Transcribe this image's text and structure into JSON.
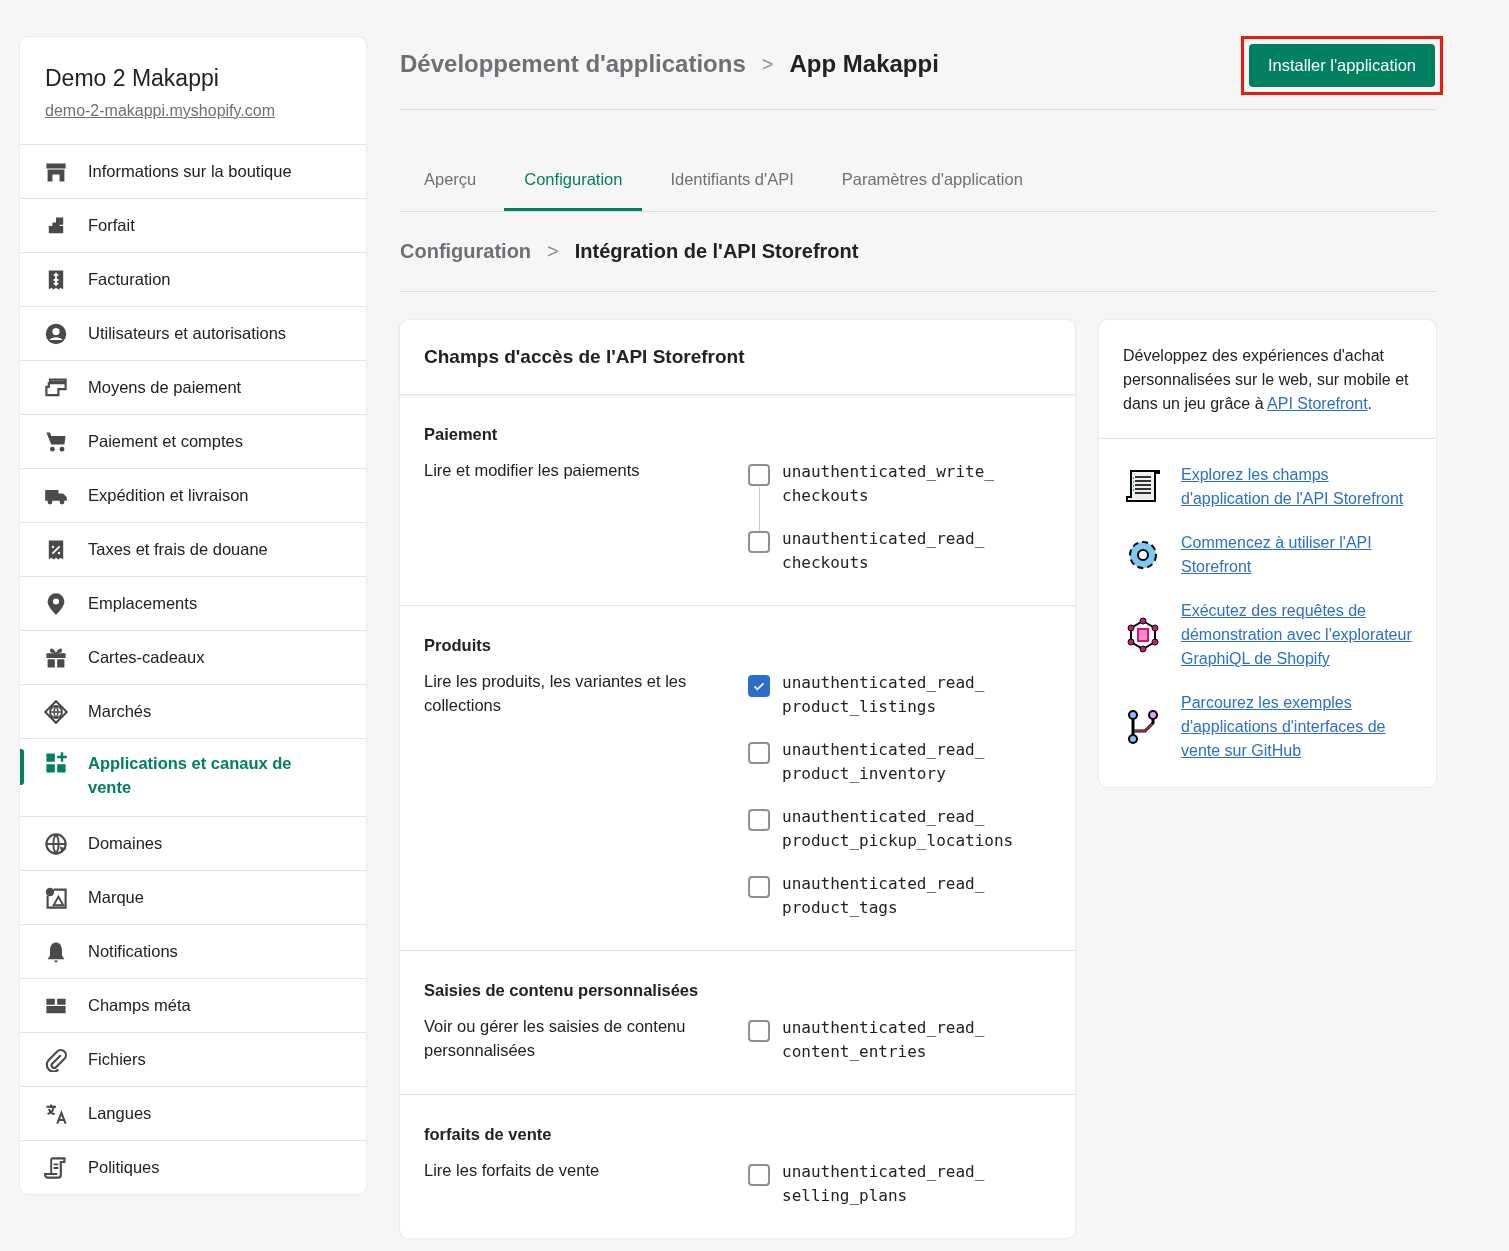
{
  "store": {
    "name": "Demo 2 Makappi",
    "domain": "demo-2-makappi.myshopify.com"
  },
  "sidebar": {
    "items": [
      {
        "label": "Informations sur la boutique",
        "selected": false
      },
      {
        "label": "Forfait",
        "selected": false
      },
      {
        "label": "Facturation",
        "selected": false
      },
      {
        "label": "Utilisateurs et autorisations",
        "selected": false
      },
      {
        "label": "Moyens de paiement",
        "selected": false
      },
      {
        "label": "Paiement et comptes",
        "selected": false
      },
      {
        "label": "Expédition et livraison",
        "selected": false
      },
      {
        "label": "Taxes et frais de douane",
        "selected": false
      },
      {
        "label": "Emplacements",
        "selected": false
      },
      {
        "label": "Cartes-cadeaux",
        "selected": false
      },
      {
        "label": "Marchés",
        "selected": false
      },
      {
        "label": "Applications et canaux de vente",
        "selected": true
      },
      {
        "label": "Domaines",
        "selected": false
      },
      {
        "label": "Marque",
        "selected": false
      },
      {
        "label": "Notifications",
        "selected": false
      },
      {
        "label": "Champs méta",
        "selected": false
      },
      {
        "label": "Fichiers",
        "selected": false
      },
      {
        "label": "Langues",
        "selected": false
      },
      {
        "label": "Politiques",
        "selected": false
      }
    ]
  },
  "breadcrumb": {
    "parent": "Développement d'applications",
    "separator": ">",
    "current": "App Makappi"
  },
  "install_button": {
    "label": "Installer l'application",
    "highlighted": true
  },
  "tabs": [
    {
      "label": "Aperçu",
      "selected": false
    },
    {
      "label": "Configuration",
      "selected": true
    },
    {
      "label": "Identifiants d'API",
      "selected": false
    },
    {
      "label": "Paramètres d'application",
      "selected": false
    }
  ],
  "sub_breadcrumb": {
    "parent": "Configuration",
    "separator": ">",
    "current": "Intégration de l'API Storefront"
  },
  "scopes_card": {
    "title": "Champs d'accès de l'API Storefront",
    "groups": [
      {
        "title": "Paiement",
        "description": "Lire et modifier les paiements",
        "scopes": [
          {
            "name": "unauthenticated_write_\ncheckouts",
            "checked": false,
            "linked_to_next": true
          },
          {
            "name": "unauthenticated_read_\ncheckouts",
            "checked": false,
            "linked_to_next": false
          }
        ]
      },
      {
        "title": "Produits",
        "description": "Lire les produits, les variantes et les collections",
        "scopes": [
          {
            "name": "unauthenticated_read_\nproduct_listings",
            "checked": true,
            "linked_to_next": false
          },
          {
            "name": "unauthenticated_read_\nproduct_inventory",
            "checked": false,
            "linked_to_next": false
          },
          {
            "name": "unauthenticated_read_\nproduct_pickup_locations",
            "checked": false,
            "linked_to_next": false
          },
          {
            "name": "unauthenticated_read_\nproduct_tags",
            "checked": false,
            "linked_to_next": false
          }
        ]
      },
      {
        "title": "Saisies de contenu personnalisées",
        "description": "Voir ou gérer les saisies de contenu personnalisées",
        "scopes": [
          {
            "name": "unauthenticated_read_\ncontent_entries",
            "checked": false,
            "linked_to_next": false
          }
        ]
      },
      {
        "title": "forfaits de vente",
        "description": "Lire les forfaits de vente",
        "scopes": [
          {
            "name": "unauthenticated_read_\nselling_plans",
            "checked": false,
            "linked_to_next": false
          }
        ]
      }
    ]
  },
  "info_card": {
    "intro": "Développez des expériences d'achat personnalisées sur le web, sur mobile et dans un jeu grâce à",
    "intro_link": "API Storefront",
    "intro_end": ".",
    "resources": [
      {
        "label": "Explorez les champs d'application de l'API Storefront"
      },
      {
        "label": "Commencez à utiliser l'API Storefront"
      },
      {
        "label": "Exécutez des requêtes de démonstration avec l'explorateur GraphiQL de Shopify"
      },
      {
        "label": "Parcourez les exemples d'applications d'interfaces de vente sur GitHub"
      }
    ]
  }
}
